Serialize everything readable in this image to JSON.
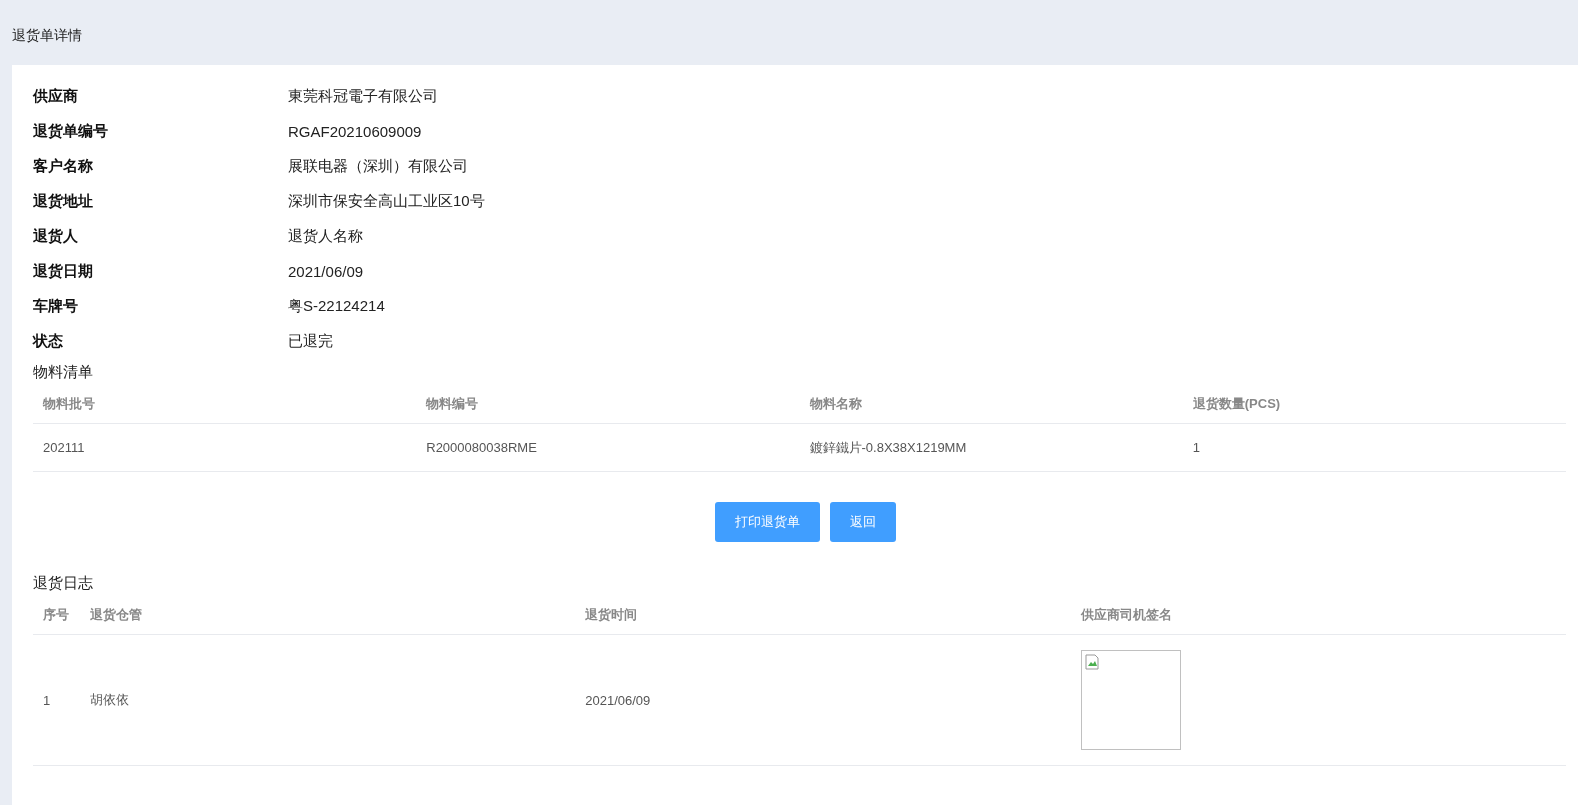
{
  "page_title": "退货单详情",
  "details": [
    {
      "label": "供应商",
      "value": "東莞科冠電子有限公司"
    },
    {
      "label": "退货单编号",
      "value": "RGAF20210609009"
    },
    {
      "label": "客户名称",
      "value": "展联电器（深圳）有限公司"
    },
    {
      "label": "退货地址",
      "value": "深圳市保安全高山工业区10号"
    },
    {
      "label": "退货人",
      "value": "退货人名称"
    },
    {
      "label": "退货日期",
      "value": "2021/06/09"
    },
    {
      "label": "车牌号",
      "value": "粤S-22124214"
    },
    {
      "label": "状态",
      "value": "已退完"
    }
  ],
  "materials": {
    "title": "物料清单",
    "columns": [
      "物料批号",
      "物料编号",
      "物料名称",
      "退货数量(PCS)"
    ],
    "rows": [
      [
        "202111",
        "R2000080038RME",
        "鍍鋅鐵片-0.8X38X1219MM",
        "1"
      ]
    ]
  },
  "buttons": [
    {
      "label": "打印退货单"
    },
    {
      "label": "返回"
    }
  ],
  "log": {
    "title": "退货日志",
    "columns": [
      "序号",
      "退货仓管",
      "退货时间",
      "供应商司机签名"
    ],
    "rows": [
      {
        "index": "1",
        "keeper": "胡依依",
        "time": "2021/06/09",
        "signature": {
          "kind": "broken-image"
        }
      }
    ]
  }
}
